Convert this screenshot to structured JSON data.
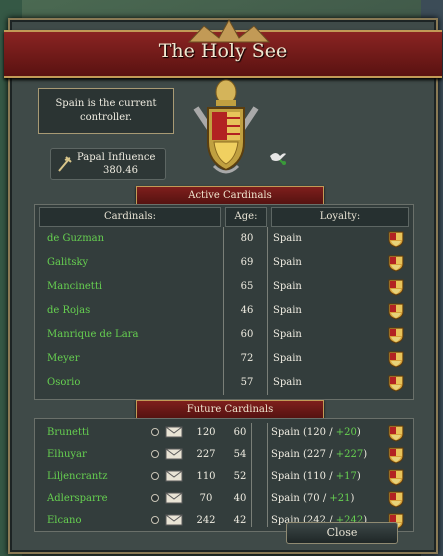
{
  "window": {
    "title": "The Holy See",
    "controller_text": "Spain is the current controller.",
    "papal_influence_label": "Papal Influence",
    "papal_influence_value": "380.46",
    "close_label": "Close"
  },
  "active_cardinals": {
    "section_title": "Active Cardinals",
    "headers": {
      "cardinals": "Cardinals:",
      "age": "Age:",
      "loyalty": "Loyalty:"
    },
    "rows": [
      {
        "name": "de Guzman",
        "age": "80",
        "loyalty": "Spain"
      },
      {
        "name": "Galitsky",
        "age": "69",
        "loyalty": "Spain"
      },
      {
        "name": "Mancinetti",
        "age": "65",
        "loyalty": "Spain"
      },
      {
        "name": "de Rojas",
        "age": "46",
        "loyalty": "Spain"
      },
      {
        "name": "Manrique de Lara",
        "age": "60",
        "loyalty": "Spain"
      },
      {
        "name": "Meyer",
        "age": "72",
        "loyalty": "Spain"
      },
      {
        "name": "Osorio",
        "age": "57",
        "loyalty": "Spain"
      }
    ]
  },
  "future_cardinals": {
    "section_title": "Future Cardinals",
    "rows": [
      {
        "name": "Brunetti",
        "score": "120",
        "age": "60",
        "loyalty_prefix": "Spain (120 / ",
        "bonus": "+20",
        "loyalty_suffix": ")"
      },
      {
        "name": "Elhuyar",
        "score": "227",
        "age": "54",
        "loyalty_prefix": "Spain (227 / ",
        "bonus": "+227",
        "loyalty_suffix": ")"
      },
      {
        "name": "Liljencrantz",
        "score": "110",
        "age": "52",
        "loyalty_prefix": "Spain (110 / ",
        "bonus": "+17",
        "loyalty_suffix": ")"
      },
      {
        "name": "Adlersparre",
        "score": "70",
        "age": "40",
        "loyalty_prefix": "Spain (70 / ",
        "bonus": "+21",
        "loyalty_suffix": ")"
      },
      {
        "name": "Elcano",
        "score": "242",
        "age": "42",
        "loyalty_prefix": "Spain (242 / ",
        "bonus": "+242",
        "loyalty_suffix": ")"
      }
    ]
  },
  "icons": {
    "influence": "papal-cross-icon",
    "shield": "spain-shield-icon",
    "envelope": "envelope-icon",
    "dove": "dove-icon",
    "coat_of_arms": "papal-coat-of-arms-icon"
  },
  "colors": {
    "name_green": "#66d050",
    "banner_red": "#7e1e1c",
    "gold": "#c29a56"
  }
}
